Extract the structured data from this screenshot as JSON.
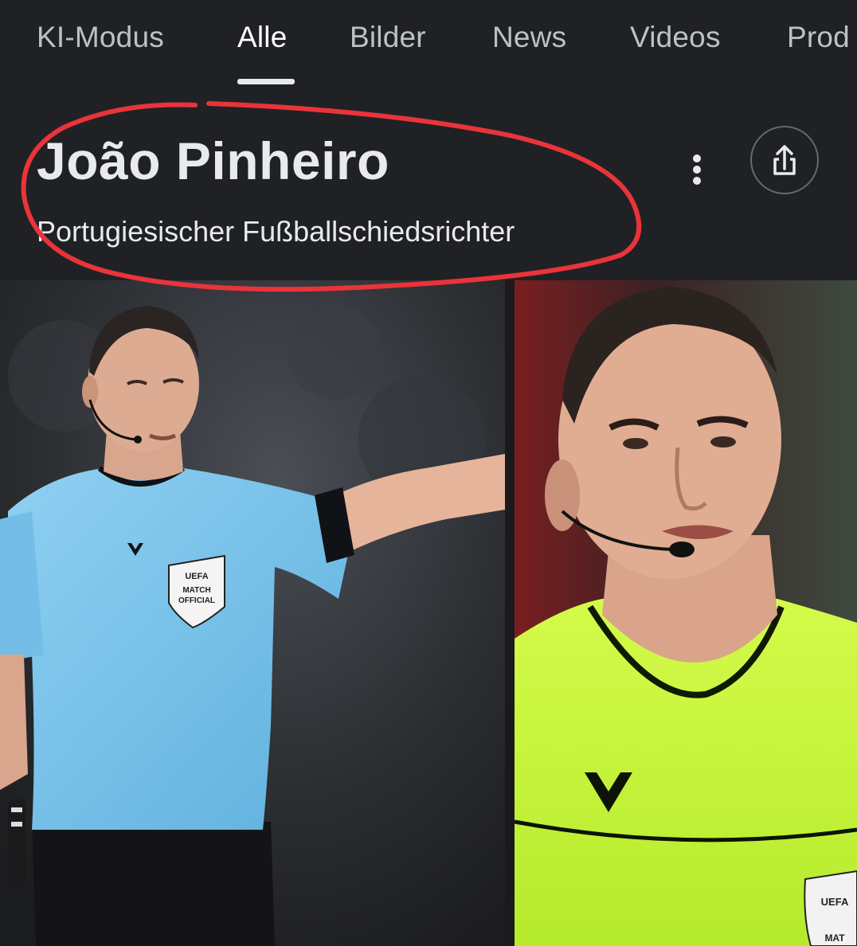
{
  "tabs": [
    {
      "label": "KI-Modus",
      "active": false
    },
    {
      "label": "Alle",
      "active": true
    },
    {
      "label": "Bilder",
      "active": false
    },
    {
      "label": "News",
      "active": false
    },
    {
      "label": "Videos",
      "active": false
    },
    {
      "label": "Prod",
      "active": false
    }
  ],
  "knowledge_panel": {
    "title": "João Pinheiro",
    "subtitle": "Portugiesischer Fußballschiedsrichter",
    "more_icon": "more-vert-icon",
    "share_icon": "share-icon"
  },
  "images": {
    "left": {
      "badge_line1": "UEFA",
      "badge_line2": "MATCH",
      "badge_line3": "OFFICIAL",
      "shirt_color": "#7fc4ea"
    },
    "right": {
      "badge_line1": "UEFA",
      "badge_line2": "MAT",
      "shirt_color": "#c6f53a"
    }
  },
  "colors": {
    "background": "#202124",
    "tab_active": "#ffffff",
    "tab_inactive": "#bdc1c6",
    "annotation": "#e8343a"
  }
}
